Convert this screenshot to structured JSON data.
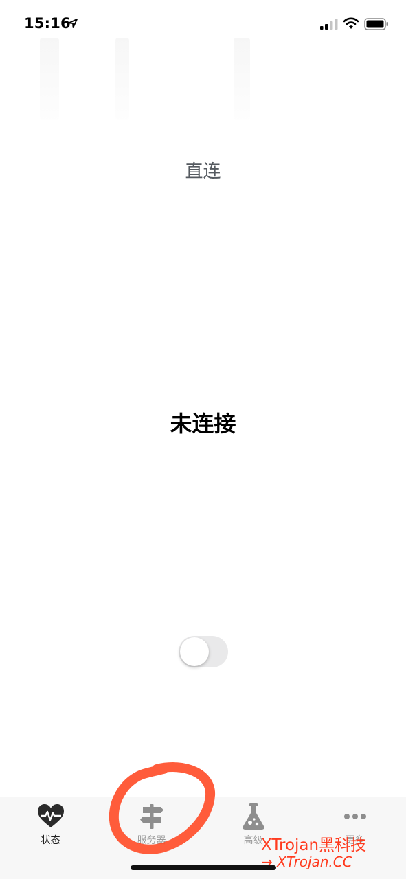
{
  "status_bar": {
    "time": "15:16"
  },
  "main": {
    "mode": "直连",
    "connection_status": "未连接",
    "toggle_on": false
  },
  "tabs": [
    {
      "label": "状态",
      "icon": "heartbeat-icon",
      "active": true
    },
    {
      "label": "服务器",
      "icon": "signpost-icon",
      "active": false
    },
    {
      "label": "高级",
      "icon": "flask-icon",
      "active": false
    },
    {
      "label": "更多",
      "icon": "more-dots-icon",
      "active": false
    }
  ],
  "watermark": {
    "line1": "XTrojan黑科技",
    "line2": "→ XTrojan.CC"
  },
  "colors": {
    "annotation": "#ff3b1f",
    "toggle_off": "#e9e9ea",
    "tab_inactive": "#9a9a9a"
  }
}
